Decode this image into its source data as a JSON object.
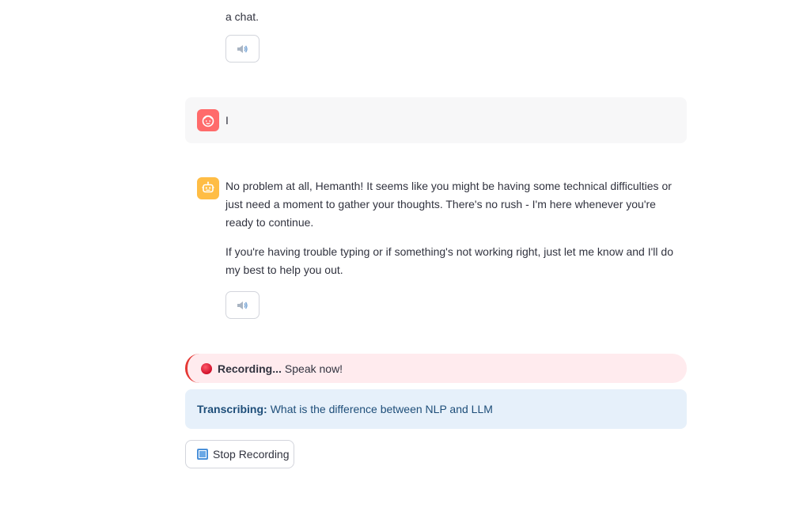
{
  "previous_message": {
    "tail_text": "a chat."
  },
  "user_message": {
    "text": "I"
  },
  "assistant_message": {
    "paragraphs": [
      "No problem at all, Hemanth! It seems like you might be having some technical difficulties or just need a moment to gather your thoughts. There's no rush - I'm here whenever you're ready to continue.",
      "If you're having trouble typing or if something's not working right, just let me know and I'll do my best to help you out."
    ]
  },
  "recording": {
    "status_label": "Recording...",
    "prompt": "Speak now!"
  },
  "transcription": {
    "label": "Transcribing:",
    "text": "What is the difference between NLP and LLM"
  },
  "controls": {
    "stop_label": "Stop Recording"
  },
  "icons": {
    "speak": "speaker-icon",
    "user_avatar": "user-face-icon",
    "bot_avatar": "robot-icon",
    "record": "red-circle-icon",
    "stop": "stop-square-icon"
  },
  "colors": {
    "user_avatar_bg": "#ff6b6b",
    "bot_avatar_bg": "#ffbd45",
    "recording_bg": "#ffebee",
    "recording_accent": "#e53935",
    "transcribe_bg": "#e6f0fa",
    "transcribe_text": "#1e4e79"
  }
}
